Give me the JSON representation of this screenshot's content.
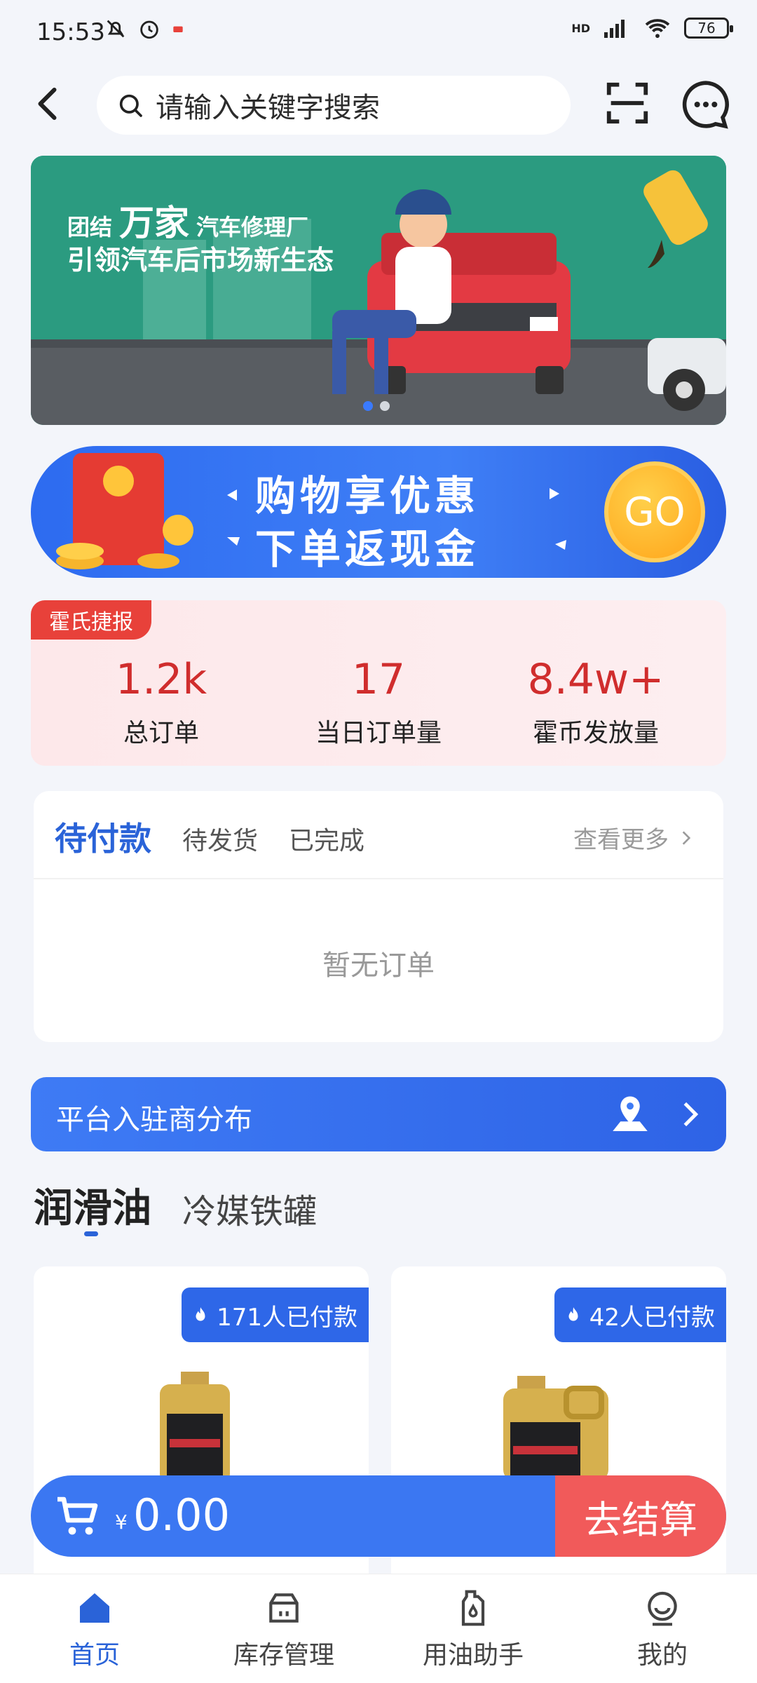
{
  "status_bar": {
    "time": "15:53",
    "network": "HD",
    "battery": "76"
  },
  "header": {
    "search_placeholder": "请输入关键字搜索"
  },
  "banner": {
    "line1_prefix": "团结",
    "line1_brand": "万家",
    "line1_suffix": "汽车修理厂",
    "line2": "引领汽车后市场新生态"
  },
  "promo": {
    "line1": "购物享优惠",
    "line2": "下单返现金",
    "go": "GO"
  },
  "stats": {
    "tag": "霍氏捷报",
    "items": [
      {
        "value": "1.2k",
        "label": "总订单"
      },
      {
        "value": "17",
        "label": "当日订单量"
      },
      {
        "value": "8.4w+",
        "label": "霍币发放量"
      }
    ]
  },
  "orders": {
    "tabs": [
      "待付款",
      "待发货",
      "已完成"
    ],
    "more": "查看更多",
    "empty": "暂无订单"
  },
  "platform": {
    "label": "平台入驻商分布"
  },
  "product_tabs": [
    "润滑油",
    "冷媒铁罐"
  ],
  "products": [
    {
      "badge": "171人已付款"
    },
    {
      "badge": "42人已付款"
    }
  ],
  "cart": {
    "currency": "¥",
    "amount": "0.00",
    "checkout": "去结算"
  },
  "nav": [
    "首页",
    "库存管理",
    "用油助手",
    "我的"
  ],
  "colors": {
    "accent": "#2a63d8",
    "red": "#e8413a",
    "checkout": "#f15a5a"
  }
}
